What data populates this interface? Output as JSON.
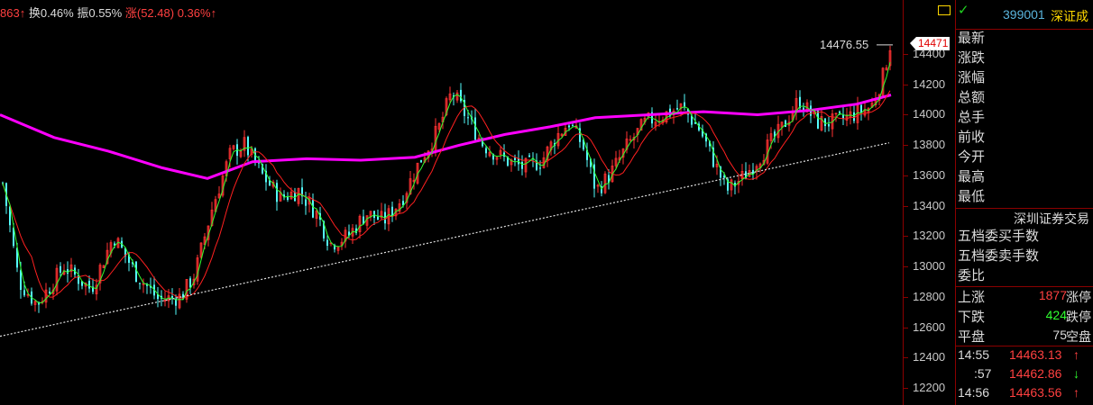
{
  "topbar": {
    "prev_partial": "863",
    "turnover_label": "换",
    "turnover": "0.46%",
    "amplitude_label": "振",
    "amplitude": "0.55%",
    "change_label": "涨",
    "change": "(52.48)",
    "change_pct": "0.36%",
    "up_arrow": "↑"
  },
  "chart": {
    "high_label": "14476.55",
    "current_price_badge": "14471",
    "y_ticks": [
      "14400",
      "14200",
      "14000",
      "13800",
      "13600",
      "13400",
      "13200",
      "13000",
      "12800",
      "12600",
      "12400",
      "12200"
    ],
    "colors": {
      "up": "#ff3232",
      "down": "#54fcfc",
      "ma_long": "#ff00ff",
      "ma_short": "#30ff30",
      "ma_mid": "#ff2020",
      "trend": "#e0e0e0"
    }
  },
  "side": {
    "code": "399001",
    "name": "深证成",
    "labels": [
      "最新",
      "涨跌",
      "涨幅",
      "总额",
      "总手",
      "前收",
      "今开",
      "最高",
      "最低"
    ],
    "exchange": "深圳证券交易",
    "depth_labels": [
      "五档委买手数",
      "五档委卖手数",
      "委比"
    ],
    "stats": [
      {
        "label": "上涨",
        "value": "1877",
        "suffix": "涨停",
        "color": "#ff4040"
      },
      {
        "label": "下跌",
        "value": "424",
        "suffix": "跌停",
        "color": "#30ff30"
      },
      {
        "label": "平盘",
        "value": "75",
        "suffix": "空盘",
        "color": "#dcdcdc"
      }
    ],
    "ticks": [
      {
        "time": "14:55",
        "price": "14463.13",
        "arrow": "↑",
        "arrow_color": "#ff4040"
      },
      {
        "time": ":57",
        "price": "14462.86",
        "arrow": "↓",
        "arrow_color": "#30ff30"
      },
      {
        "time": "14:56",
        "price": "14463.56",
        "arrow": "↑",
        "arrow_color": "#ff4040"
      }
    ]
  }
}
